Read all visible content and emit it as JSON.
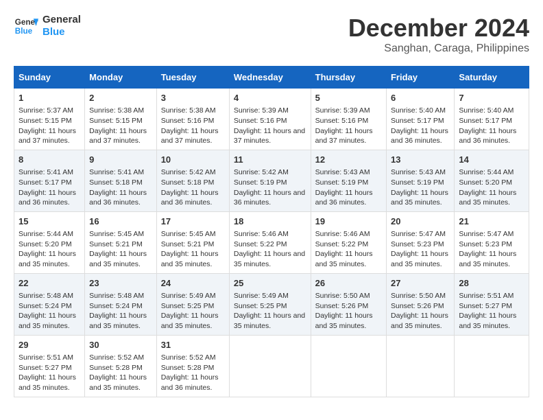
{
  "header": {
    "logo_line1": "General",
    "logo_line2": "Blue",
    "title": "December 2024",
    "subtitle": "Sanghan, Caraga, Philippines"
  },
  "days_of_week": [
    "Sunday",
    "Monday",
    "Tuesday",
    "Wednesday",
    "Thursday",
    "Friday",
    "Saturday"
  ],
  "weeks": [
    [
      {
        "day": "1",
        "sunrise": "5:37 AM",
        "sunset": "5:15 PM",
        "daylight": "11 hours and 37 minutes."
      },
      {
        "day": "2",
        "sunrise": "5:38 AM",
        "sunset": "5:15 PM",
        "daylight": "11 hours and 37 minutes."
      },
      {
        "day": "3",
        "sunrise": "5:38 AM",
        "sunset": "5:16 PM",
        "daylight": "11 hours and 37 minutes."
      },
      {
        "day": "4",
        "sunrise": "5:39 AM",
        "sunset": "5:16 PM",
        "daylight": "11 hours and 37 minutes."
      },
      {
        "day": "5",
        "sunrise": "5:39 AM",
        "sunset": "5:16 PM",
        "daylight": "11 hours and 37 minutes."
      },
      {
        "day": "6",
        "sunrise": "5:40 AM",
        "sunset": "5:17 PM",
        "daylight": "11 hours and 36 minutes."
      },
      {
        "day": "7",
        "sunrise": "5:40 AM",
        "sunset": "5:17 PM",
        "daylight": "11 hours and 36 minutes."
      }
    ],
    [
      {
        "day": "8",
        "sunrise": "5:41 AM",
        "sunset": "5:17 PM",
        "daylight": "11 hours and 36 minutes."
      },
      {
        "day": "9",
        "sunrise": "5:41 AM",
        "sunset": "5:18 PM",
        "daylight": "11 hours and 36 minutes."
      },
      {
        "day": "10",
        "sunrise": "5:42 AM",
        "sunset": "5:18 PM",
        "daylight": "11 hours and 36 minutes."
      },
      {
        "day": "11",
        "sunrise": "5:42 AM",
        "sunset": "5:19 PM",
        "daylight": "11 hours and 36 minutes."
      },
      {
        "day": "12",
        "sunrise": "5:43 AM",
        "sunset": "5:19 PM",
        "daylight": "11 hours and 36 minutes."
      },
      {
        "day": "13",
        "sunrise": "5:43 AM",
        "sunset": "5:19 PM",
        "daylight": "11 hours and 35 minutes."
      },
      {
        "day": "14",
        "sunrise": "5:44 AM",
        "sunset": "5:20 PM",
        "daylight": "11 hours and 35 minutes."
      }
    ],
    [
      {
        "day": "15",
        "sunrise": "5:44 AM",
        "sunset": "5:20 PM",
        "daylight": "11 hours and 35 minutes."
      },
      {
        "day": "16",
        "sunrise": "5:45 AM",
        "sunset": "5:21 PM",
        "daylight": "11 hours and 35 minutes."
      },
      {
        "day": "17",
        "sunrise": "5:45 AM",
        "sunset": "5:21 PM",
        "daylight": "11 hours and 35 minutes."
      },
      {
        "day": "18",
        "sunrise": "5:46 AM",
        "sunset": "5:22 PM",
        "daylight": "11 hours and 35 minutes."
      },
      {
        "day": "19",
        "sunrise": "5:46 AM",
        "sunset": "5:22 PM",
        "daylight": "11 hours and 35 minutes."
      },
      {
        "day": "20",
        "sunrise": "5:47 AM",
        "sunset": "5:23 PM",
        "daylight": "11 hours and 35 minutes."
      },
      {
        "day": "21",
        "sunrise": "5:47 AM",
        "sunset": "5:23 PM",
        "daylight": "11 hours and 35 minutes."
      }
    ],
    [
      {
        "day": "22",
        "sunrise": "5:48 AM",
        "sunset": "5:24 PM",
        "daylight": "11 hours and 35 minutes."
      },
      {
        "day": "23",
        "sunrise": "5:48 AM",
        "sunset": "5:24 PM",
        "daylight": "11 hours and 35 minutes."
      },
      {
        "day": "24",
        "sunrise": "5:49 AM",
        "sunset": "5:25 PM",
        "daylight": "11 hours and 35 minutes."
      },
      {
        "day": "25",
        "sunrise": "5:49 AM",
        "sunset": "5:25 PM",
        "daylight": "11 hours and 35 minutes."
      },
      {
        "day": "26",
        "sunrise": "5:50 AM",
        "sunset": "5:26 PM",
        "daylight": "11 hours and 35 minutes."
      },
      {
        "day": "27",
        "sunrise": "5:50 AM",
        "sunset": "5:26 PM",
        "daylight": "11 hours and 35 minutes."
      },
      {
        "day": "28",
        "sunrise": "5:51 AM",
        "sunset": "5:27 PM",
        "daylight": "11 hours and 35 minutes."
      }
    ],
    [
      {
        "day": "29",
        "sunrise": "5:51 AM",
        "sunset": "5:27 PM",
        "daylight": "11 hours and 35 minutes."
      },
      {
        "day": "30",
        "sunrise": "5:52 AM",
        "sunset": "5:28 PM",
        "daylight": "11 hours and 35 minutes."
      },
      {
        "day": "31",
        "sunrise": "5:52 AM",
        "sunset": "5:28 PM",
        "daylight": "11 hours and 36 minutes."
      },
      null,
      null,
      null,
      null
    ]
  ],
  "labels": {
    "sunrise": "Sunrise:",
    "sunset": "Sunset:",
    "daylight": "Daylight:"
  }
}
